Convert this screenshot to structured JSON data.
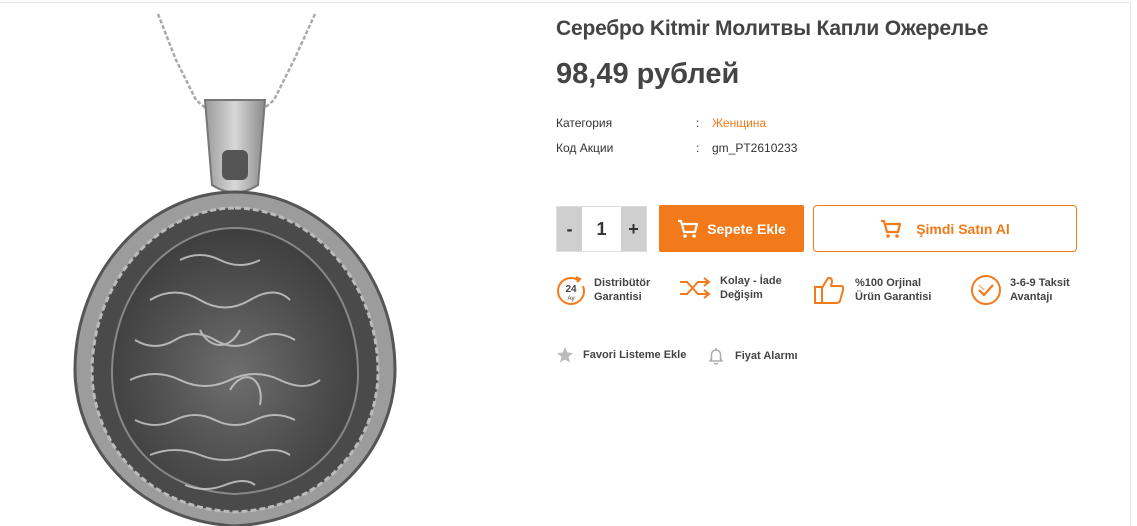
{
  "product": {
    "title": "Серебро Kitmir Молитвы Капли Ожерелье",
    "price": "98,49 рублей",
    "image_alt": "Silver teardrop pendant necklace with engraved prayer"
  },
  "meta": [
    {
      "label": "Категория",
      "sep": ":",
      "value": "Женщина"
    },
    {
      "label": "Код Акции",
      "sep": ":",
      "value": "gm_PT2610233"
    }
  ],
  "purchase": {
    "minus": "-",
    "quantity": "1",
    "plus": "+",
    "add_to_cart": "Sepete Ekle",
    "buy_now": "Şimdi Satın Al"
  },
  "features": [
    {
      "icon": "24-month-badge-icon",
      "badge_top": "24",
      "badge_bottom": "Ay",
      "line1": "Distribütör",
      "line2": "Garantisi"
    },
    {
      "icon": "shuffle-return-icon",
      "line1": "Kolay - İade",
      "line2": "Değişim"
    },
    {
      "icon": "thumbs-up-icon",
      "line1": "%100 Orjinal",
      "line2": "Ürün Garantisi"
    },
    {
      "icon": "check-badge-icon",
      "line1": "3-6-9 Taksit",
      "line2": "Avantajı"
    }
  ],
  "actions": {
    "favorite": "Favori Listeme Ekle",
    "price_alarm": "Fiyat Alarmı"
  },
  "colors": {
    "accent": "#f27a1a",
    "text": "#444444",
    "qty_button": "#cfcfcf"
  }
}
